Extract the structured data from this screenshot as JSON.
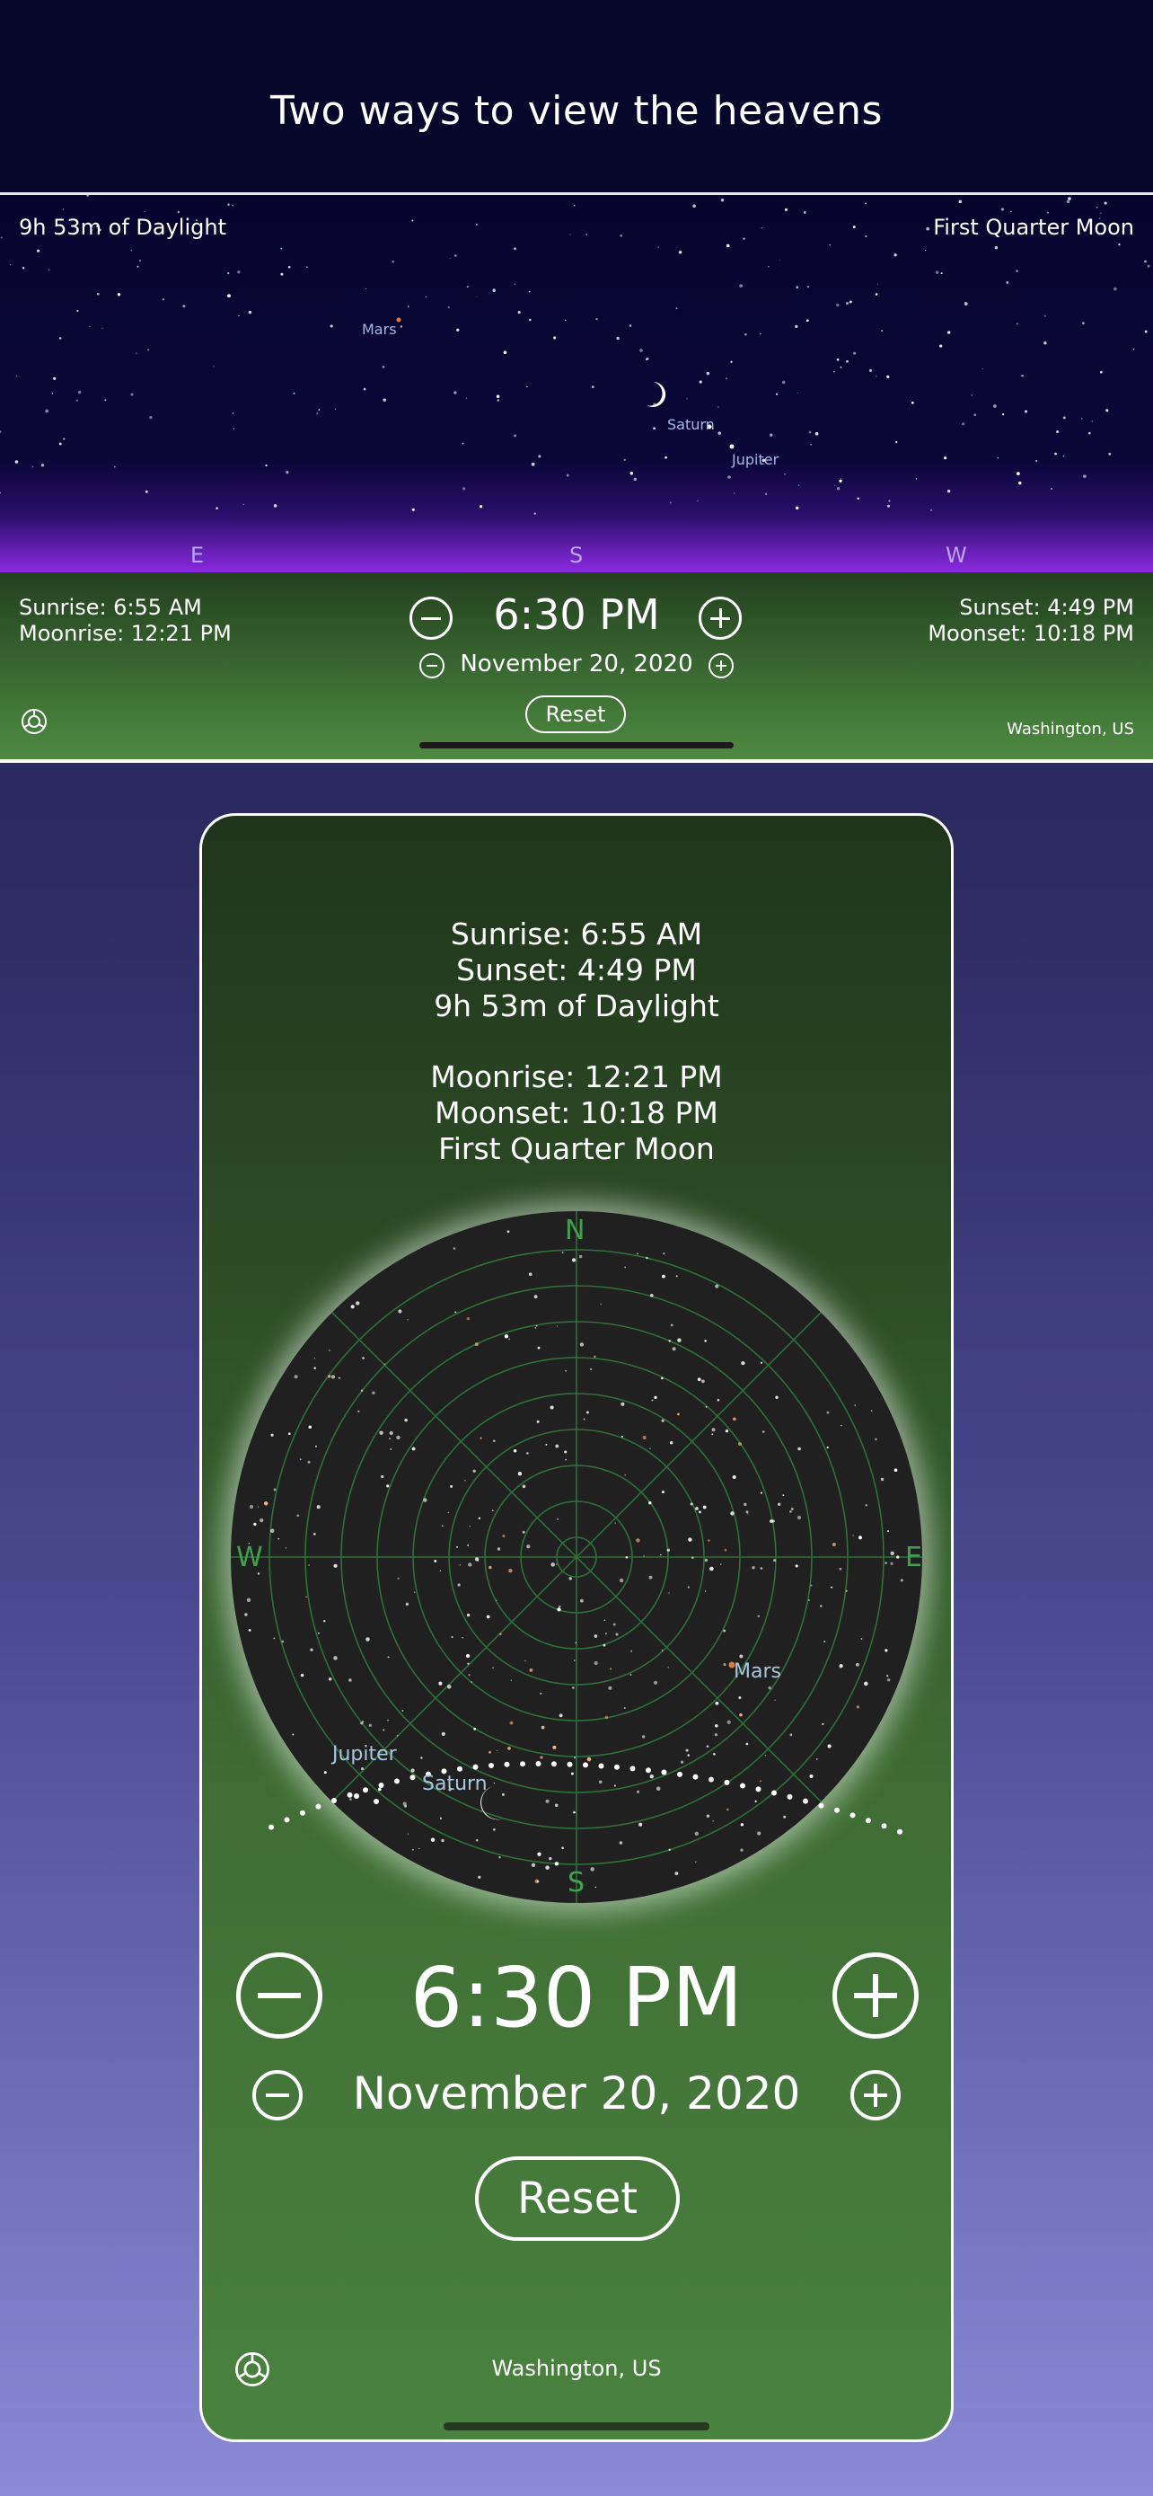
{
  "hero": {
    "title": "Two ways to view the heavens"
  },
  "landscape": {
    "daylight": "9h 53m of Daylight",
    "moon_phase": "First Quarter Moon",
    "planets": {
      "mars": "Mars",
      "saturn": "Saturn",
      "jupiter": "Jupiter"
    },
    "compass": {
      "east": "E",
      "south": "S",
      "west": "W"
    },
    "sunrise": "Sunrise: 6:55 AM",
    "moonrise": "Moonrise: 12:21 PM",
    "sunset": "Sunset: 4:49 PM",
    "moonset": "Moonset: 10:18 PM",
    "time": "6:30 PM",
    "date": "November 20, 2020",
    "reset_label": "Reset",
    "location": "Washington, US"
  },
  "phone": {
    "sunrise": "Sunrise: 6:55 AM",
    "sunset": "Sunset: 4:49 PM",
    "daylight": "9h 53m of Daylight",
    "moonrise": "Moonrise: 12:21 PM",
    "moonset": "Moonset: 10:18 PM",
    "moon_phase": "First Quarter Moon",
    "compass": {
      "north": "N",
      "east": "E",
      "south": "S",
      "west": "W"
    },
    "planets": {
      "mars": "Mars",
      "jupiter": "Jupiter",
      "saturn": "Saturn"
    },
    "time": "6:30 PM",
    "date": "November 20, 2020",
    "reset_label": "Reset",
    "location": "Washington, US"
  },
  "colors": {
    "sky": "#07052e",
    "ground": "#3a6a32",
    "grid": "#2e6f3a",
    "compass_green": "#3fa050",
    "mars": "#e07a3a"
  },
  "icons": {
    "minus": "minus-circle-icon",
    "plus": "plus-circle-icon",
    "settings": "gear-icon",
    "moon": "crescent-moon-icon"
  }
}
